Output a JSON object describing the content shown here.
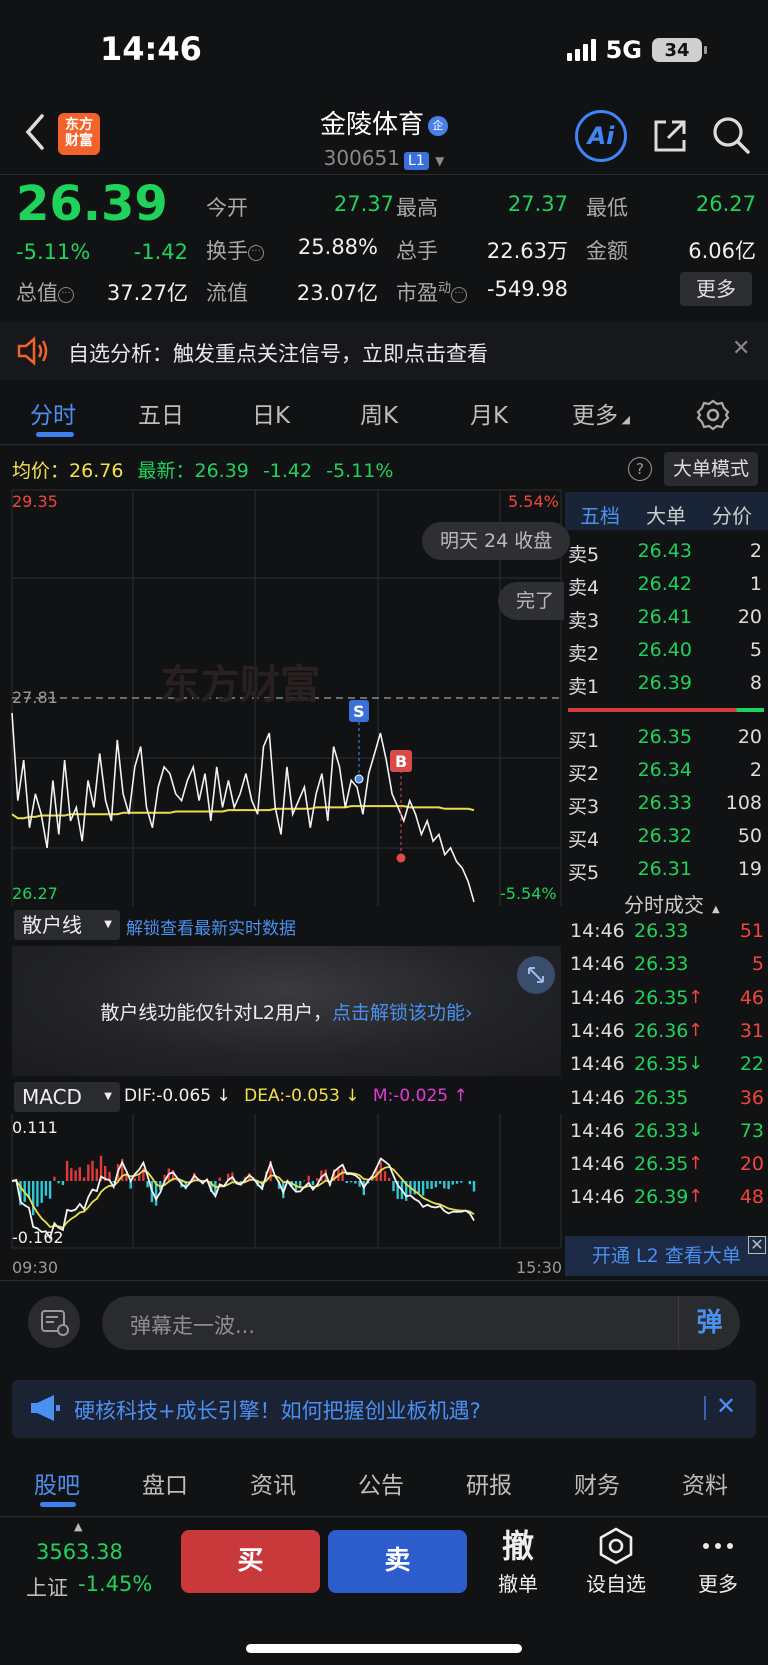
{
  "status_bar": {
    "time": "14:46",
    "network": "5G",
    "battery": "34"
  },
  "header": {
    "app_logo": "东方\n财富",
    "stock_name": "金陵体育",
    "name_tag": "企",
    "stock_code": "300651",
    "level": "L1",
    "ai_label": "Ai"
  },
  "quote": {
    "price": "26.39",
    "change_pct": "-5.11%",
    "change": "-1.42",
    "items": [
      {
        "label": "今开",
        "value": "27.37",
        "color": "#1fd25a"
      },
      {
        "label": "最高",
        "value": "27.37",
        "color": "#1fd25a"
      },
      {
        "label": "最低",
        "value": "26.27",
        "color": "#1fd25a"
      },
      {
        "label": "换手",
        "value": "25.88%",
        "color": "#f0f0f0"
      },
      {
        "label": "总手",
        "value": "22.63万",
        "color": "#f0f0f0"
      },
      {
        "label": "金额",
        "value": "6.06亿",
        "color": "#f0f0f0"
      },
      {
        "label": "总值",
        "value": "37.27亿",
        "color": "#f0f0f0"
      },
      {
        "label": "流值",
        "value": "23.07亿",
        "color": "#f0f0f0"
      },
      {
        "label": "市盈",
        "sup": "动",
        "value": "-549.98",
        "color": "#f0f0f0"
      }
    ],
    "more_label": "更多"
  },
  "notice": {
    "text": "自选分析：触发重点关注信号，立即点击查看"
  },
  "chart_tabs": [
    "分时",
    "五日",
    "日K",
    "周K",
    "月K",
    "更多"
  ],
  "chart_info": {
    "avg_label": "均价：",
    "avg_value": "26.76",
    "latest_label": "最新：",
    "latest_value": "26.39",
    "latest_change": "-1.42",
    "latest_pct": "-5.11%",
    "help": "?",
    "mode_button": "大单模式"
  },
  "intraday": {
    "y_max": "29.35",
    "y_ref": "27.81",
    "y_min": "26.27",
    "pct_max": "5.54%",
    "pct_min": "-5.54%",
    "watermark": "东方财富",
    "danmaku": [
      "明天 24 收盘",
      "完了"
    ],
    "markers": [
      "S",
      "B"
    ],
    "time_start": "09:30",
    "time_end": "15:30"
  },
  "chart_data": {
    "type": "line",
    "ylim": [
      26.27,
      29.35
    ],
    "series": [
      {
        "name": "最新",
        "values": [
          27.7,
          27.05,
          27.35,
          26.85,
          27.1,
          26.95,
          26.7,
          27.2,
          26.8,
          27.35,
          26.9,
          27.0,
          26.75,
          27.2,
          27.0,
          27.4,
          27.05,
          26.9,
          27.5,
          27.1,
          26.95,
          27.3,
          27.45,
          27.0,
          26.85,
          27.15,
          27.3,
          27.25,
          27.1,
          27.05,
          27.2,
          27.3,
          27.05,
          27.25,
          26.9,
          27.3,
          27.0,
          27.2,
          27.0,
          27.1,
          27.25,
          27.05,
          26.95,
          27.45,
          27.55,
          27.0,
          26.8,
          27.3,
          26.95,
          27.05,
          27.15,
          26.85,
          27.1,
          27.25,
          26.9,
          27.45,
          27.3,
          27.0,
          27.2,
          27.15,
          26.95,
          27.25,
          27.4,
          27.55,
          27.35,
          27.1,
          27.0,
          26.9,
          27.05,
          26.95,
          26.8,
          26.9,
          26.75,
          26.8,
          26.65,
          26.7,
          26.6,
          26.55,
          26.45,
          26.3
        ]
      },
      {
        "name": "均价",
        "values": [
          26.95,
          26.92,
          26.92,
          26.93,
          26.93,
          26.94,
          26.94,
          26.94,
          26.94,
          26.94,
          26.95,
          26.95,
          26.95,
          26.95,
          26.95,
          26.95,
          26.95,
          26.95,
          26.95,
          26.96,
          26.96,
          26.96,
          26.96,
          26.96,
          26.96,
          26.96,
          26.96,
          26.96,
          26.97,
          26.97,
          26.97,
          26.97,
          26.97,
          26.97,
          26.97,
          26.97,
          26.97,
          26.98,
          26.98,
          26.98,
          26.98,
          26.98,
          26.98,
          26.98,
          26.98,
          26.99,
          26.99,
          26.99,
          26.99,
          26.99,
          26.99,
          26.99,
          27.0,
          27.0,
          27.0,
          27.0,
          27.0,
          27.0,
          27.01,
          27.01,
          27.01,
          27.01,
          27.01,
          27.01,
          27.01,
          27.01,
          27.01,
          27.01,
          27.0,
          27.0,
          27.0,
          27.0,
          27.0,
          27.0,
          26.99,
          26.99,
          26.99,
          26.99,
          26.99,
          26.98
        ]
      }
    ]
  },
  "retail": {
    "label": "散户线",
    "unlock_link": "解锁查看最新实时数据",
    "message": "散户线功能仅针对L2用户，",
    "message_link": "点击解锁该功能›"
  },
  "macd": {
    "label": "MACD",
    "dif": "DIF:-0.065 ↓",
    "dea": "DEA:-0.053 ↓",
    "m": "M:-0.025 ↑",
    "y_max": "0.111",
    "y_min": "-0.162"
  },
  "order_book": {
    "tabs": [
      "五档",
      "大单",
      "分价"
    ],
    "asks": [
      {
        "label": "卖5",
        "price": "26.43",
        "vol": "2"
      },
      {
        "label": "卖4",
        "price": "26.42",
        "vol": "1"
      },
      {
        "label": "卖3",
        "price": "26.41",
        "vol": "20"
      },
      {
        "label": "卖2",
        "price": "26.40",
        "vol": "5"
      },
      {
        "label": "卖1",
        "price": "26.39",
        "vol": "8"
      }
    ],
    "bids": [
      {
        "label": "买1",
        "price": "26.35",
        "vol": "20"
      },
      {
        "label": "买2",
        "price": "26.34",
        "vol": "2"
      },
      {
        "label": "买3",
        "price": "26.33",
        "vol": "108"
      },
      {
        "label": "买4",
        "price": "26.32",
        "vol": "50"
      },
      {
        "label": "买5",
        "price": "26.31",
        "vol": "19"
      }
    ],
    "trades_title": "分时成交",
    "trades": [
      {
        "time": "14:46",
        "price": "26.33",
        "arrow": "",
        "vol": "51",
        "vol_color": "#f2453d"
      },
      {
        "time": "14:46",
        "price": "26.33",
        "arrow": "",
        "vol": "5",
        "vol_color": "#f2453d"
      },
      {
        "time": "14:46",
        "price": "26.35",
        "arrow": "↑",
        "arrow_color": "#f2453d",
        "vol": "46",
        "vol_color": "#f2453d"
      },
      {
        "time": "14:46",
        "price": "26.36",
        "arrow": "↑",
        "arrow_color": "#f2453d",
        "vol": "31",
        "vol_color": "#f2453d"
      },
      {
        "time": "14:46",
        "price": "26.35",
        "arrow": "↓",
        "arrow_color": "#1fd25a",
        "vol": "22",
        "vol_color": "#1fd25a"
      },
      {
        "time": "14:46",
        "price": "26.35",
        "arrow": "",
        "vol": "36",
        "vol_color": "#f2453d"
      },
      {
        "time": "14:46",
        "price": "26.33",
        "arrow": "↓",
        "arrow_color": "#1fd25a",
        "vol": "73",
        "vol_color": "#1fd25a"
      },
      {
        "time": "14:46",
        "price": "26.35",
        "arrow": "↑",
        "arrow_color": "#f2453d",
        "vol": "20",
        "vol_color": "#f2453d"
      },
      {
        "time": "14:46",
        "price": "26.39",
        "arrow": "↑",
        "arrow_color": "#f2453d",
        "vol": "48",
        "vol_color": "#f2453d"
      }
    ],
    "l2_banner": "开通 L2 查看大单"
  },
  "danmaku_bar": {
    "placeholder": "弹幕走一波...",
    "send": "弹"
  },
  "ad": {
    "text": "硬核科技+成长引擎！如何把握创业板机遇?"
  },
  "bottom_tabs": [
    "股吧",
    "盘口",
    "资讯",
    "公告",
    "研报",
    "财务",
    "资料"
  ],
  "bottom_bar": {
    "index_value": "3563.38",
    "index_name": "上证",
    "index_pct": "-1.45%",
    "buy": "买",
    "sell": "卖",
    "cancel_icon": "撤",
    "cancel": "撤单",
    "watch": "设自选",
    "more": "更多"
  },
  "colors": {
    "up": "#f2453d",
    "down": "#1fd25a",
    "accent": "#4a90f0",
    "avg": "#f4e04a"
  }
}
